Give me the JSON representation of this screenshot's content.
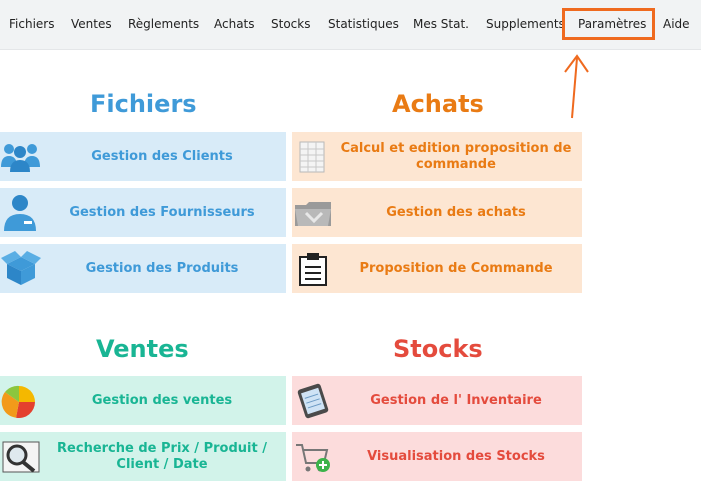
{
  "menu": {
    "items": [
      {
        "label": "Fichiers"
      },
      {
        "label": "Ventes"
      },
      {
        "label": "Règlements"
      },
      {
        "label": "Achats"
      },
      {
        "label": "Stocks"
      },
      {
        "label": "Statistiques"
      },
      {
        "label": "Mes Stat."
      },
      {
        "label": "Supplements"
      },
      {
        "label": "Paramètres"
      },
      {
        "label": "Aide"
      }
    ],
    "highlight_color": "#ef6a1f"
  },
  "sections": {
    "fichiers": {
      "title": "Fichiers",
      "color": "#3f9ad8",
      "items": [
        {
          "label": "Gestion des Clients",
          "icon": "users-icon"
        },
        {
          "label": "Gestion des Fournisseurs",
          "icon": "supplier-icon"
        },
        {
          "label": "Gestion des Produits",
          "icon": "box-icon"
        }
      ]
    },
    "achats": {
      "title": "Achats",
      "color": "#e97b14",
      "items": [
        {
          "label": "Calcul et edition proposition de commande",
          "icon": "spreadsheet-icon"
        },
        {
          "label": "Gestion des achats",
          "icon": "folder-icon"
        },
        {
          "label": "Proposition de Commande",
          "icon": "clipboard-icon"
        }
      ]
    },
    "ventes": {
      "title": "Ventes",
      "color": "#19b594",
      "items": [
        {
          "label": "Gestion des ventes",
          "icon": "pie-chart-icon"
        },
        {
          "label": "Recherche de Prix / Produit / Client / Date",
          "icon": "magnifier-icon"
        }
      ]
    },
    "stocks": {
      "title": "Stocks",
      "color": "#e44b3d",
      "items": [
        {
          "label": "Gestion de l' Inventaire",
          "icon": "notepad-icon"
        },
        {
          "label": "Visualisation des Stocks",
          "icon": "cart-icon"
        }
      ]
    }
  }
}
